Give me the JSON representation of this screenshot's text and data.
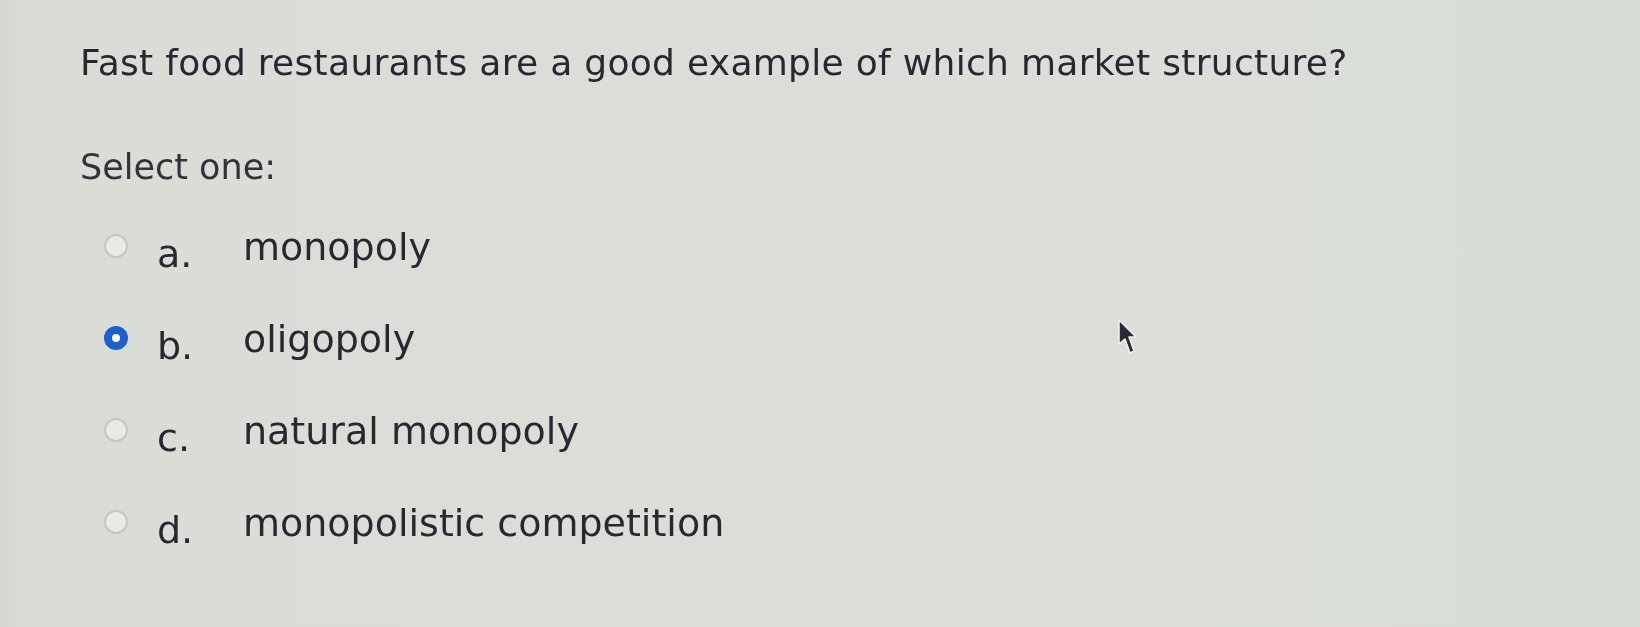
{
  "question": {
    "text": "Fast food restaurants are a good example of which market structure?"
  },
  "instruction": "Select one:",
  "options": [
    {
      "letter": "a.",
      "label": "monopoly",
      "selected": false
    },
    {
      "letter": "b.",
      "label": "oligopoly",
      "selected": true
    },
    {
      "letter": "c.",
      "label": "natural monopoly",
      "selected": false
    },
    {
      "letter": "d.",
      "label": "monopolistic competition",
      "selected": false
    }
  ]
}
